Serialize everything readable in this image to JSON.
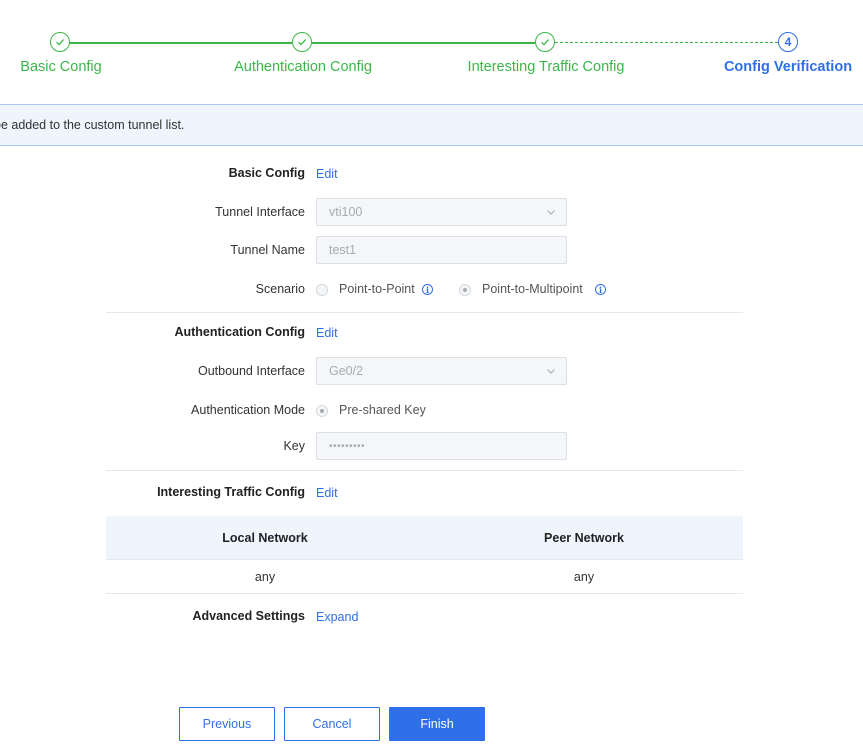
{
  "stepper": {
    "steps": [
      {
        "label": "Basic Config",
        "state": "done"
      },
      {
        "label": "Authentication Config",
        "state": "done"
      },
      {
        "label": "Interesting Traffic Config",
        "state": "done"
      },
      {
        "label": "Config Verification",
        "state": "active",
        "number": "4"
      }
    ]
  },
  "info_bar": {
    "text": "be added to the custom tunnel list."
  },
  "basic_config": {
    "title": "Basic Config",
    "edit_label": "Edit",
    "tunnel_interface_label": "Tunnel Interface",
    "tunnel_interface_value": "vti100",
    "tunnel_name_label": "Tunnel Name",
    "tunnel_name_value": "test1",
    "scenario_label": "Scenario",
    "scenario_options": [
      "Point-to-Point",
      "Point-to-Multipoint"
    ],
    "scenario_selected": "Point-to-Multipoint"
  },
  "auth_config": {
    "title": "Authentication Config",
    "edit_label": "Edit",
    "outbound_interface_label": "Outbound Interface",
    "outbound_interface_value": "Ge0/2",
    "auth_mode_label": "Authentication Mode",
    "auth_mode_value": "Pre-shared Key",
    "key_label": "Key",
    "key_value": "•••••••••"
  },
  "traffic_config": {
    "title": "Interesting Traffic Config",
    "edit_label": "Edit",
    "columns": [
      "Local Network",
      "Peer Network"
    ],
    "rows": [
      [
        "any",
        "any"
      ]
    ]
  },
  "advanced": {
    "title": "Advanced Settings",
    "expand_label": "Expand"
  },
  "footer": {
    "previous_label": "Previous",
    "cancel_label": "Cancel",
    "finish_label": "Finish"
  },
  "colors": {
    "success": "#3cb64a",
    "primary": "#2f6fe8",
    "info_bg": "#eef5fd"
  }
}
